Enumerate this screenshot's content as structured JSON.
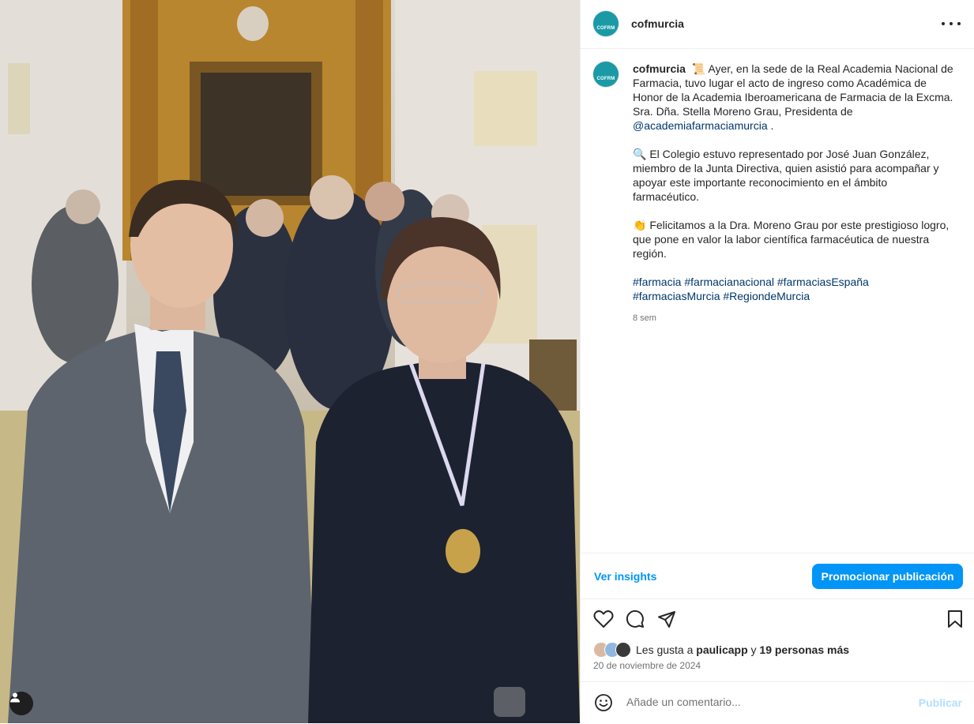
{
  "post": {
    "username": "cofmurcia",
    "avatar_label": "COFRM",
    "more_icon": "more-horizontal-icon"
  },
  "caption": {
    "username": "cofmurcia",
    "p1_emoji": "📜",
    "p1_text": "Ayer, en la sede de la Real Academia Nacional de Farmacia, tuvo lugar el acto de ingreso como Académica de Honor de la Academia Iberoamericana de Farmacia de la Excma. Sra. Dña. Stella Moreno Grau, Presidenta de",
    "p1_mention": "@academiafarmaciamurcia",
    "p1_end": " .",
    "p2_emoji": "🔍",
    "p2_text": "El Colegio estuvo representado por José Juan González, miembro de la Junta Directiva, quien asistió para acompañar y apoyar este importante reconocimiento en el ámbito farmacéutico.",
    "p3_emoji": "👏",
    "p3_text": "Felicitamos a la Dra. Moreno Grau por este prestigioso logro, que pone en valor la labor científica farmacéutica de nuestra región.",
    "hashtags": [
      "#farmacia",
      "#farmacianacional",
      "#farmaciasEspaña",
      "#farmaciasMurcia",
      "#RegiondeMurcia"
    ],
    "time_ago": "8 sem"
  },
  "insights": {
    "link_label": "Ver insights",
    "promote_label": "Promocionar publicación"
  },
  "likes": {
    "prefix": "Les gusta a",
    "user": "paulicapp",
    "connector": "y",
    "others": "19 personas más"
  },
  "date": "20 de noviembre de 2024",
  "comment": {
    "placeholder": "Añade un comentario...",
    "publish_label": "Publicar"
  },
  "colors": {
    "accent": "#0095f6",
    "link": "#00376b",
    "muted": "#737373",
    "brand": "#1b9aa6"
  }
}
